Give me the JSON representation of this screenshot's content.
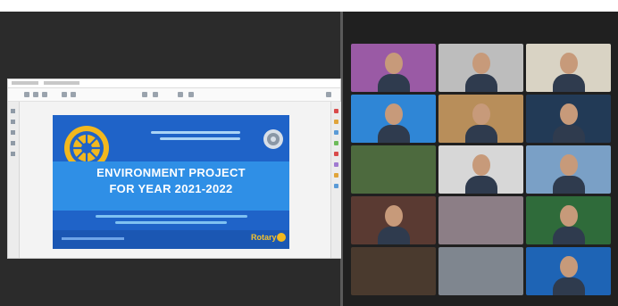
{
  "slide": {
    "title_line1": "ENVIRONMENT PROJECT",
    "title_line2": "FOR YEAR 2021-2022",
    "brand": "Rotary",
    "colors": {
      "slide_bg": "#1f63c8",
      "band": "#2f8fe6",
      "gold": "#f2b81e"
    }
  },
  "app": {
    "window_bg": "#2b2b2b",
    "gallery_bg": "#202020"
  },
  "gallery": [
    {
      "name": "",
      "bg": "#9a5aa5",
      "person": true
    },
    {
      "name": "",
      "bg": "#bdbdbd",
      "person": true
    },
    {
      "name": "",
      "bg": "#d9d3c4",
      "person": true
    },
    {
      "name": "",
      "bg": "#2f86d6",
      "person": true
    },
    {
      "name": "",
      "bg": "#b88e5a",
      "person": true
    },
    {
      "name": "",
      "bg": "#223a56",
      "person": true
    },
    {
      "name": "",
      "bg": "#4d6a3e",
      "person": false
    },
    {
      "name": "",
      "bg": "#d7d7d7",
      "person": true
    },
    {
      "name": "",
      "bg": "#7aa0c6",
      "person": true
    },
    {
      "name": "",
      "bg": "#5a3a32",
      "person": true
    },
    {
      "name": "",
      "bg": "#8c7e86",
      "person": false
    },
    {
      "name": "",
      "bg": "#2f6b3a",
      "person": true
    },
    {
      "name": "",
      "bg": "#4a3a2e",
      "person": false
    },
    {
      "name": "",
      "bg": "#7f868f",
      "person": false
    },
    {
      "name": "",
      "bg": "#1e64b5",
      "person": true
    }
  ]
}
